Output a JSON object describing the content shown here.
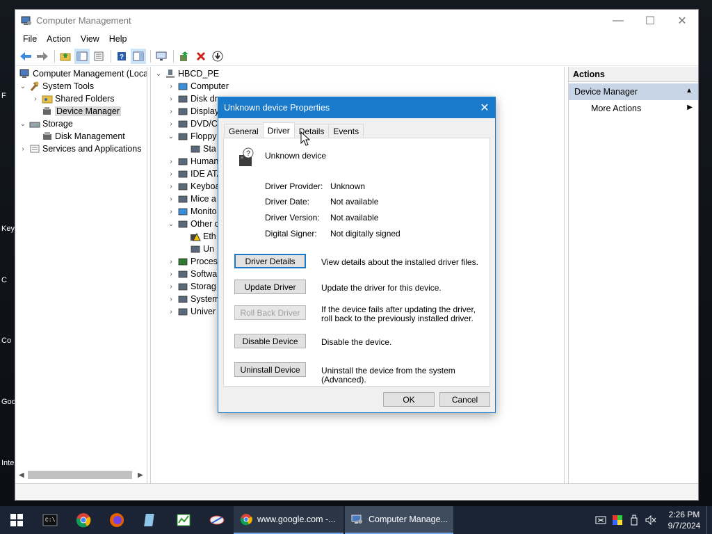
{
  "desktop": {
    "side_labels": [
      "F",
      "Key",
      "C",
      "Co",
      "Goo",
      "Inte"
    ]
  },
  "window": {
    "title": "Computer Management",
    "menu": [
      "File",
      "Action",
      "View",
      "Help"
    ]
  },
  "left_tree": {
    "root": "Computer Management (Local",
    "system_tools": "System Tools",
    "shared_folders": "Shared Folders",
    "device_manager": "Device Manager",
    "storage": "Storage",
    "disk_management": "Disk Management",
    "services": "Services and Applications"
  },
  "device_tree": {
    "root": "HBCD_PE",
    "items": [
      "Computer",
      "Disk dr",
      "Display",
      "DVD/C",
      "Floppy",
      "Sta",
      "Human",
      "IDE ATA",
      "Keyboa",
      "Mice a",
      "Monito",
      "Other d",
      "Eth",
      "Un",
      "Proces",
      "Softwa",
      "Storag",
      "System",
      "Univer"
    ]
  },
  "actions": {
    "header": "Actions",
    "section": "Device Manager",
    "more": "More Actions"
  },
  "dialog": {
    "title": "Unknown device Properties",
    "tabs": [
      "General",
      "Driver",
      "Details",
      "Events"
    ],
    "active_tab": "Driver",
    "device_name": "Unknown device",
    "props": {
      "provider_label": "Driver Provider:",
      "provider_value": "Unknown",
      "date_label": "Driver Date:",
      "date_value": "Not available",
      "version_label": "Driver Version:",
      "version_value": "Not available",
      "signer_label": "Digital Signer:",
      "signer_value": "Not digitally signed"
    },
    "buttons": {
      "details": "Driver Details",
      "details_desc": "View details about the installed driver files.",
      "update": "Update Driver",
      "update_desc": "Update the driver for this device.",
      "rollback": "Roll Back Driver",
      "rollback_desc": "If the device fails after updating the driver, roll back to the previously installed driver.",
      "disable": "Disable Device",
      "disable_desc": "Disable the device.",
      "uninstall": "Uninstall Device",
      "uninstall_desc": "Uninstall the device from the system (Advanced).",
      "ok": "OK",
      "cancel": "Cancel"
    }
  },
  "taskbar": {
    "chrome_task": "www.google.com -...",
    "cm_task": "Computer Manage...",
    "time": "2:26 PM",
    "date": "9/7/2024"
  },
  "colors": {
    "accent": "#1979ca",
    "taskbar": "#1b2434",
    "actions_section": "#c7d5e6"
  }
}
